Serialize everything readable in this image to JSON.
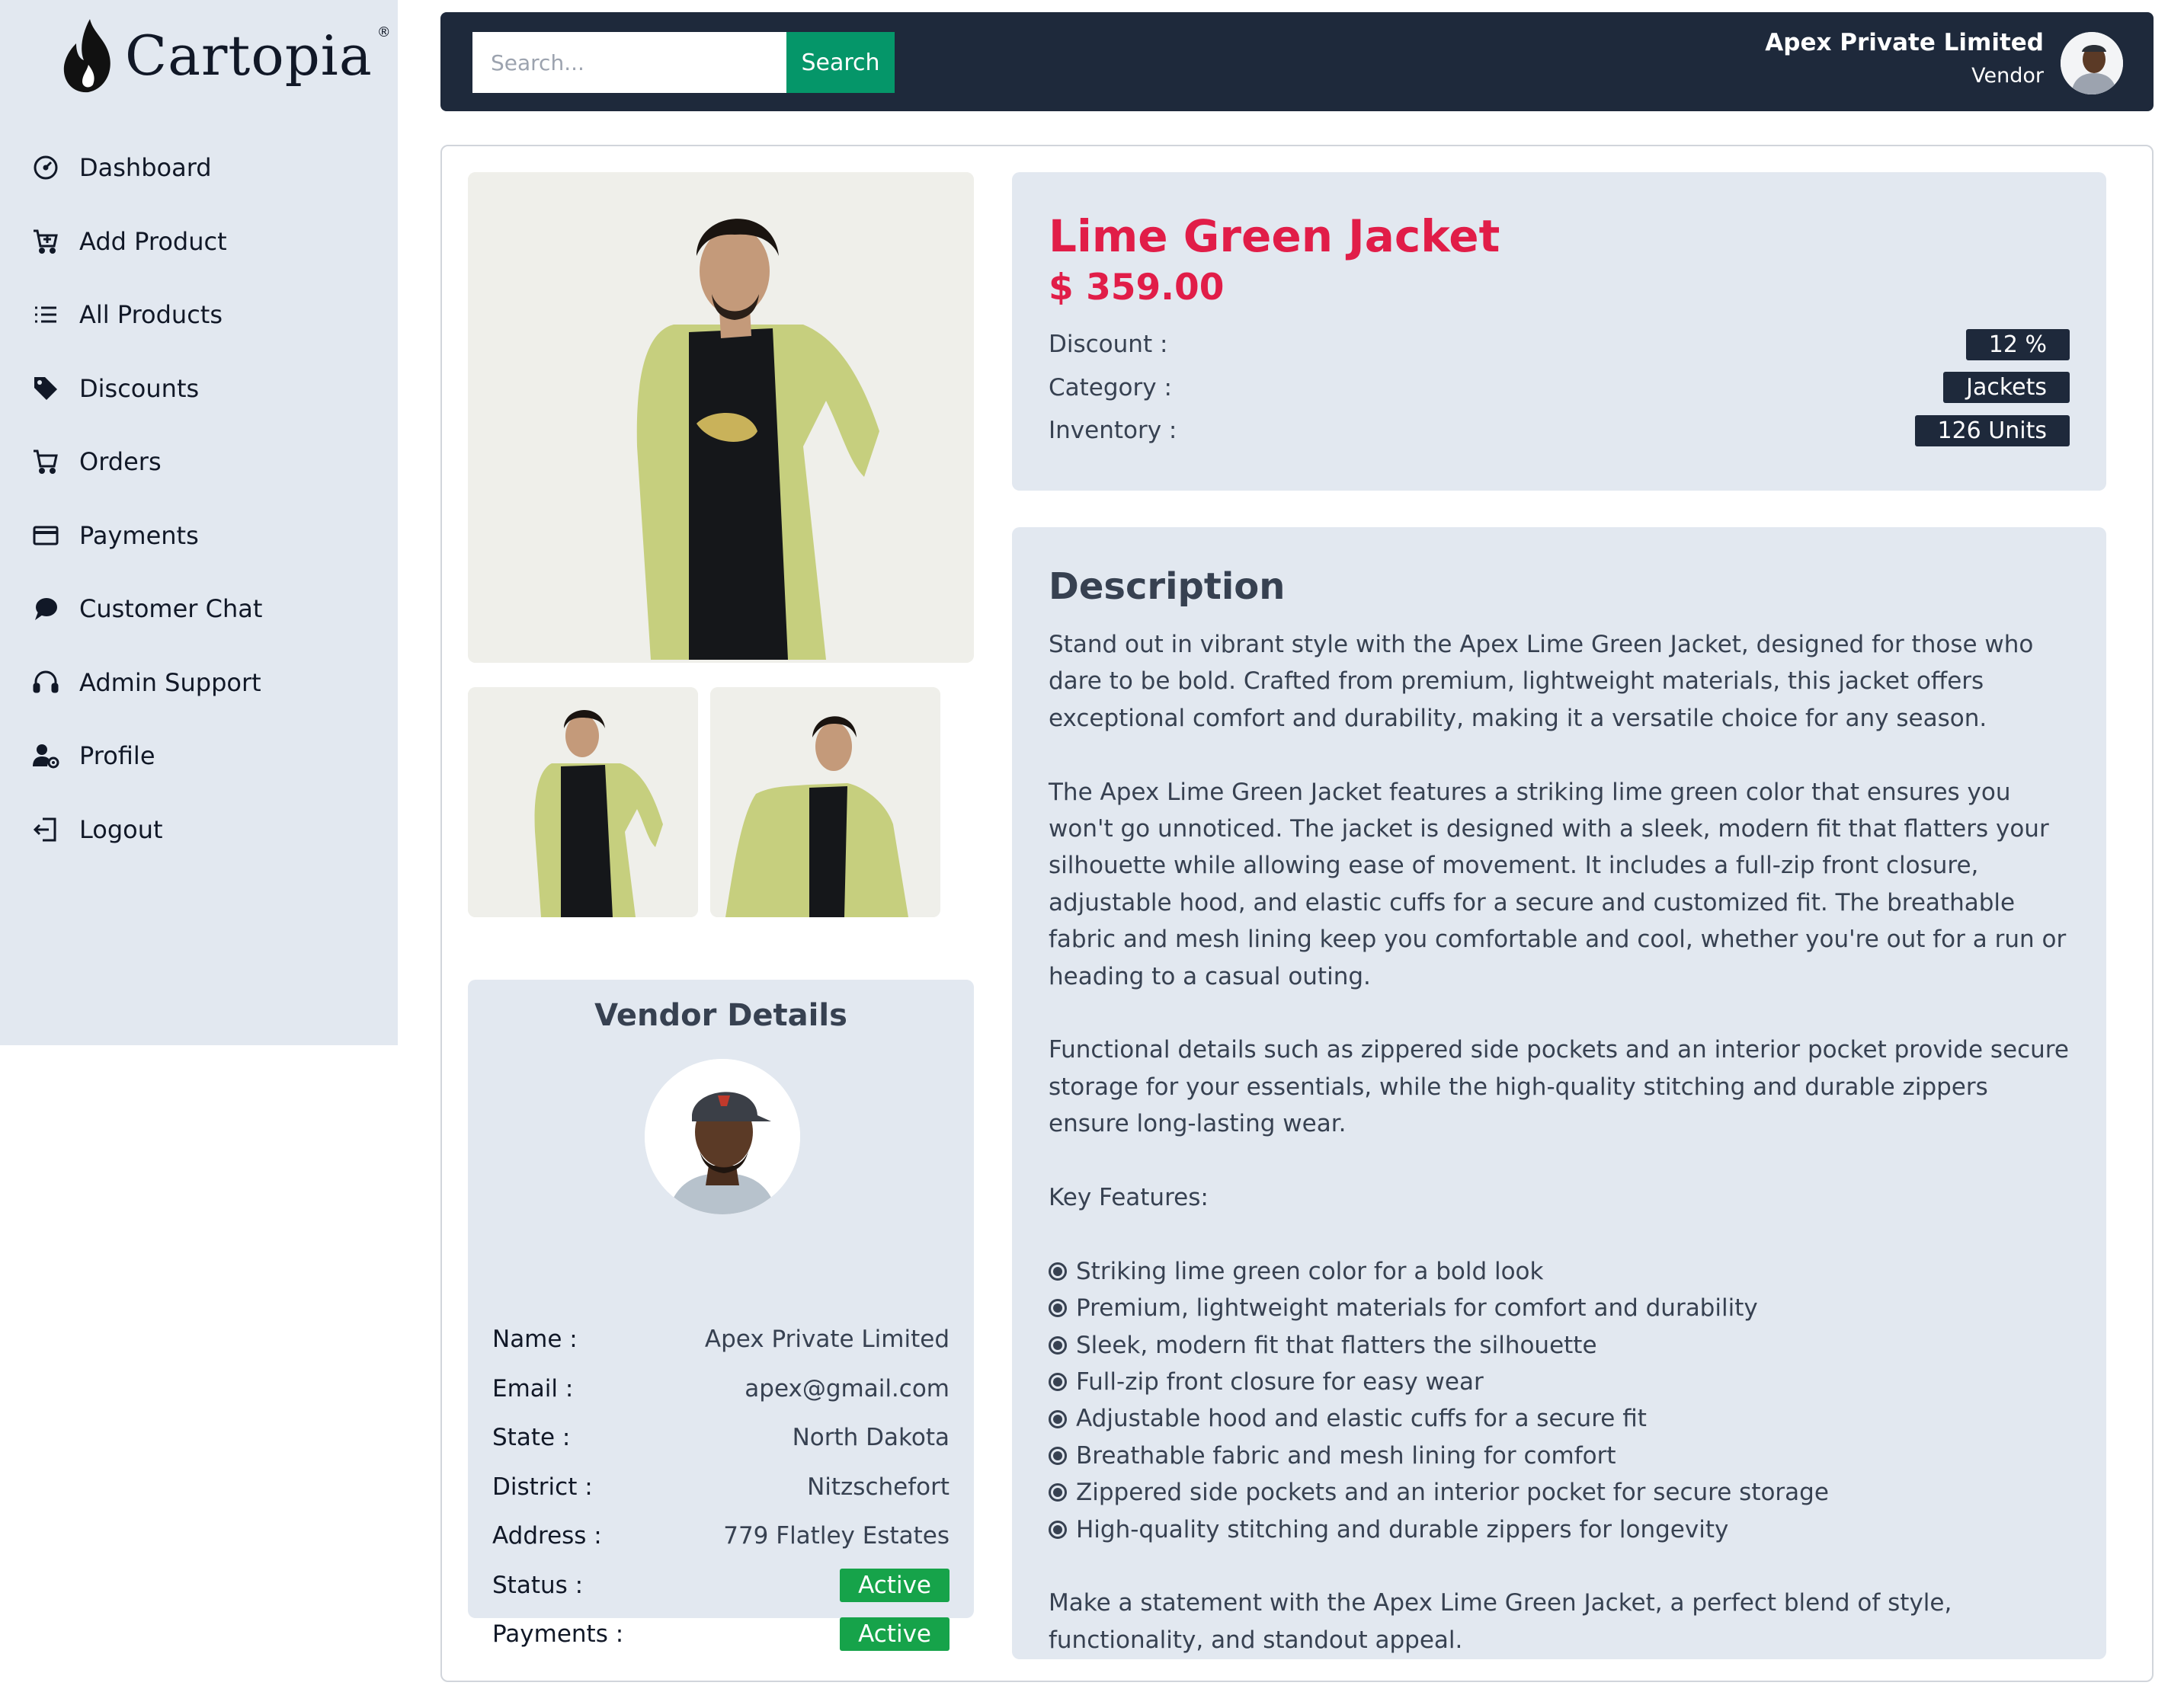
{
  "app": {
    "name": "Cartopia",
    "reg_mark": "®"
  },
  "sidebar": {
    "items": [
      {
        "label": "Dashboard",
        "icon": "dashboard-gauge-icon"
      },
      {
        "label": "Add Product",
        "icon": "cart-plus-icon"
      },
      {
        "label": "All Products",
        "icon": "list-icon"
      },
      {
        "label": "Discounts",
        "icon": "tag-icon"
      },
      {
        "label": "Orders",
        "icon": "cart-icon"
      },
      {
        "label": "Payments",
        "icon": "credit-card-icon"
      },
      {
        "label": "Customer Chat",
        "icon": "chat-icon"
      },
      {
        "label": "Admin Support",
        "icon": "headset-icon"
      },
      {
        "label": "Profile",
        "icon": "user-gear-icon"
      },
      {
        "label": "Logout",
        "icon": "logout-icon"
      }
    ]
  },
  "header": {
    "search_placeholder": "Search...",
    "search_value": "",
    "search_button": "Search",
    "user_name": "Apex Private Limited",
    "user_role": "Vendor"
  },
  "product": {
    "title": "Lime Green Jacket",
    "price": "$ 359.00",
    "details": [
      {
        "label": "Discount :",
        "value": "12 %"
      },
      {
        "label": "Category :",
        "value": "Jackets"
      },
      {
        "label": "Inventory :",
        "value": "126 Units"
      }
    ]
  },
  "description": {
    "title": "Description",
    "paragraphs": [
      "Stand out in vibrant style with the Apex Lime Green Jacket, designed for those who dare to be bold. Crafted from premium, lightweight materials, this jacket offers exceptional comfort and durability, making it a versatile choice for any season.",
      "The Apex Lime Green Jacket features a striking lime green color that ensures you won't go unnoticed. The jacket is designed with a sleek, modern fit that flatters your silhouette while allowing ease of movement. It includes a full-zip front closure, adjustable hood, and elastic cuffs for a secure and customized fit. The breathable fabric and mesh lining keep you comfortable and cool, whether you're out for a run or heading to a casual outing.",
      "Functional details such as zippered side pockets and an interior pocket provide secure storage for your essentials, while the high-quality stitching and durable zippers ensure long-lasting wear.",
      "Key Features:"
    ],
    "features": [
      "Striking lime green color for a bold look",
      "Premium, lightweight materials for comfort and durability",
      "Sleek, modern fit that flatters the silhouette",
      "Full-zip front closure for easy wear",
      "Adjustable hood and elastic cuffs for a secure fit",
      "Breathable fabric and mesh lining for comfort",
      "Zippered side pockets and an interior pocket for secure storage",
      "High-quality stitching and durable zippers for longevity"
    ],
    "closing": "Make a statement with the Apex Lime Green Jacket, a perfect blend of style, functionality, and standout appeal."
  },
  "vendor": {
    "title": "Vendor Details",
    "rows": [
      {
        "label": "Name :",
        "value": "Apex Private Limited"
      },
      {
        "label": "Email :",
        "value": "apex@gmail.com"
      },
      {
        "label": "State :",
        "value": "North Dakota"
      },
      {
        "label": "District :",
        "value": "Nitzschefort"
      },
      {
        "label": "Address :",
        "value": "779 Flatley Estates"
      }
    ],
    "status_label": "Status :",
    "status_value": "Active",
    "payments_label": "Payments :",
    "payments_value": "Active"
  },
  "colors": {
    "sidebar_bg": "#e2e8f0",
    "topbar_bg": "#1e293b",
    "accent_green": "#059669",
    "title_red": "#e11d48",
    "badge_dark": "#1e293b",
    "badge_active": "#16a34a"
  }
}
